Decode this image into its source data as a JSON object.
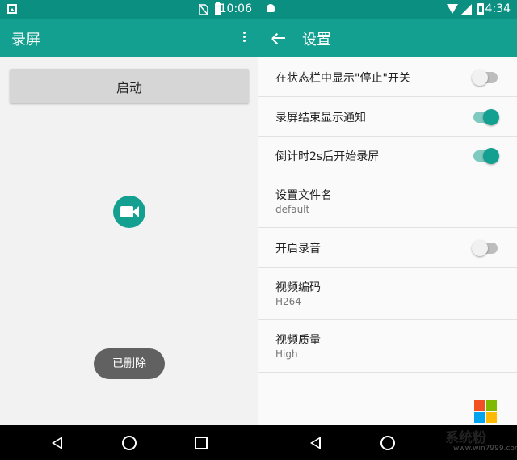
{
  "left": {
    "status_time": "10:06",
    "app_title": "录屏",
    "start_button": "启动",
    "toast": "已删除"
  },
  "right": {
    "status_time": "4:34",
    "app_title": "设置",
    "prefs": [
      {
        "title": "在状态栏中显示\"停止\"开关",
        "switch": "off"
      },
      {
        "title": "录屏结束显示通知",
        "switch": "on"
      },
      {
        "title": "倒计时2s后开始录屏",
        "switch": "on"
      },
      {
        "title": "设置文件名",
        "summary": "default"
      },
      {
        "title": "开启录音",
        "switch": "off"
      },
      {
        "title": "视频编码",
        "summary": "H264"
      },
      {
        "title": "视频质量",
        "summary": "High"
      }
    ]
  },
  "watermark": {
    "text": "系统粉",
    "url": "www.win7999.com"
  },
  "colors": {
    "status_bar": "#0b8f81",
    "app_bar": "#14a090",
    "accent": "#14a090"
  }
}
